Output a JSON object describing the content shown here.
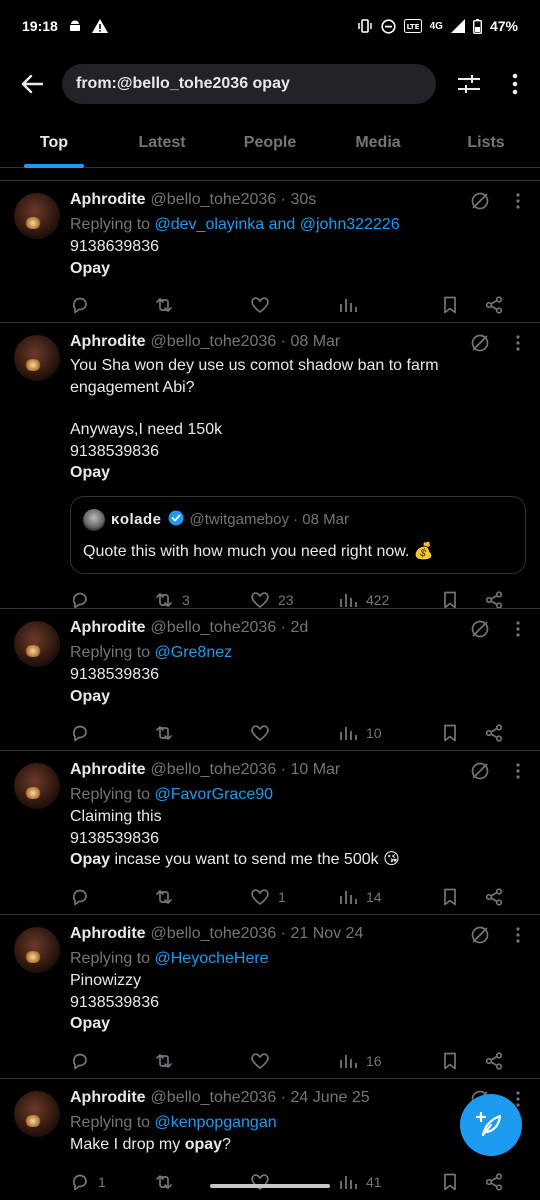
{
  "status": {
    "time": "19:18",
    "network": "4G",
    "battery": "47%"
  },
  "search": {
    "query": "from:@bello_tohe2036 opay"
  },
  "tabs": [
    {
      "label": "Top"
    },
    {
      "label": "Latest"
    },
    {
      "label": "People"
    },
    {
      "label": "Media"
    },
    {
      "label": "Lists"
    }
  ],
  "colors": {
    "accent": "#1d9bf0",
    "background": "#000000",
    "muted": "#71767b"
  },
  "tweets": [
    {
      "name": "Aphrodite",
      "handle": "@bello_tohe2036 · 30s",
      "replying": "Replying to ",
      "mentions": "@dev_olayinka and @john322226",
      "line1": "9138639836",
      "line2": "Opay",
      "comments": "",
      "retweets": "",
      "likes": "",
      "views": ""
    },
    {
      "name": "Aphrodite",
      "handle": "@bello_tohe2036 · 08 Mar",
      "text1": "You Sha won dey use us comot shadow ban to farm engagement Abi?",
      "text2": "Anyways,I need 150k",
      "line1": "9138539836",
      "line2": "Opay",
      "quote": {
        "name": "ĸolade",
        "handle": "@twitgameboy · 08 Mar",
        "text": "Quote this with how much you need right now. 💰"
      },
      "comments": "",
      "retweets": "3",
      "likes": "23",
      "views": "422"
    },
    {
      "name": "Aphrodite",
      "handle": "@bello_tohe2036 · 2d",
      "replying": "Replying to ",
      "mentions": "@Gre8nez",
      "line1": "9138539836",
      "line2": "Opay",
      "comments": "",
      "retweets": "",
      "likes": "",
      "views": "10"
    },
    {
      "name": "Aphrodite",
      "handle": "@bello_tohe2036 · 10 Mar",
      "replying": "Replying to ",
      "mentions": "@FavorGrace90",
      "text1": "Claiming this",
      "line1": "9138539836",
      "line2": "Opay",
      "line2rest": " incase you want to send me the 500k 😘",
      "comments": "",
      "retweets": "",
      "likes": "1",
      "views": "14"
    },
    {
      "name": "Aphrodite",
      "handle": "@bello_tohe2036 · 21 Nov 24",
      "replying": "Replying to ",
      "mentions": "@HeyocheHere",
      "text1": "Pinowizzy",
      "line1": "9138539836",
      "line2": "Opay",
      "comments": "",
      "retweets": "",
      "likes": "",
      "views": "16"
    },
    {
      "name": "Aphrodite",
      "handle": "@bello_tohe2036 · 24 June 25",
      "replying": "Replying to ",
      "mentions": "@kenpopgangan",
      "text1": "Make I drop my ",
      "bold1": "opay",
      "text2": "?",
      "comments": "1",
      "retweets": "",
      "likes": "",
      "views": "41"
    }
  ]
}
